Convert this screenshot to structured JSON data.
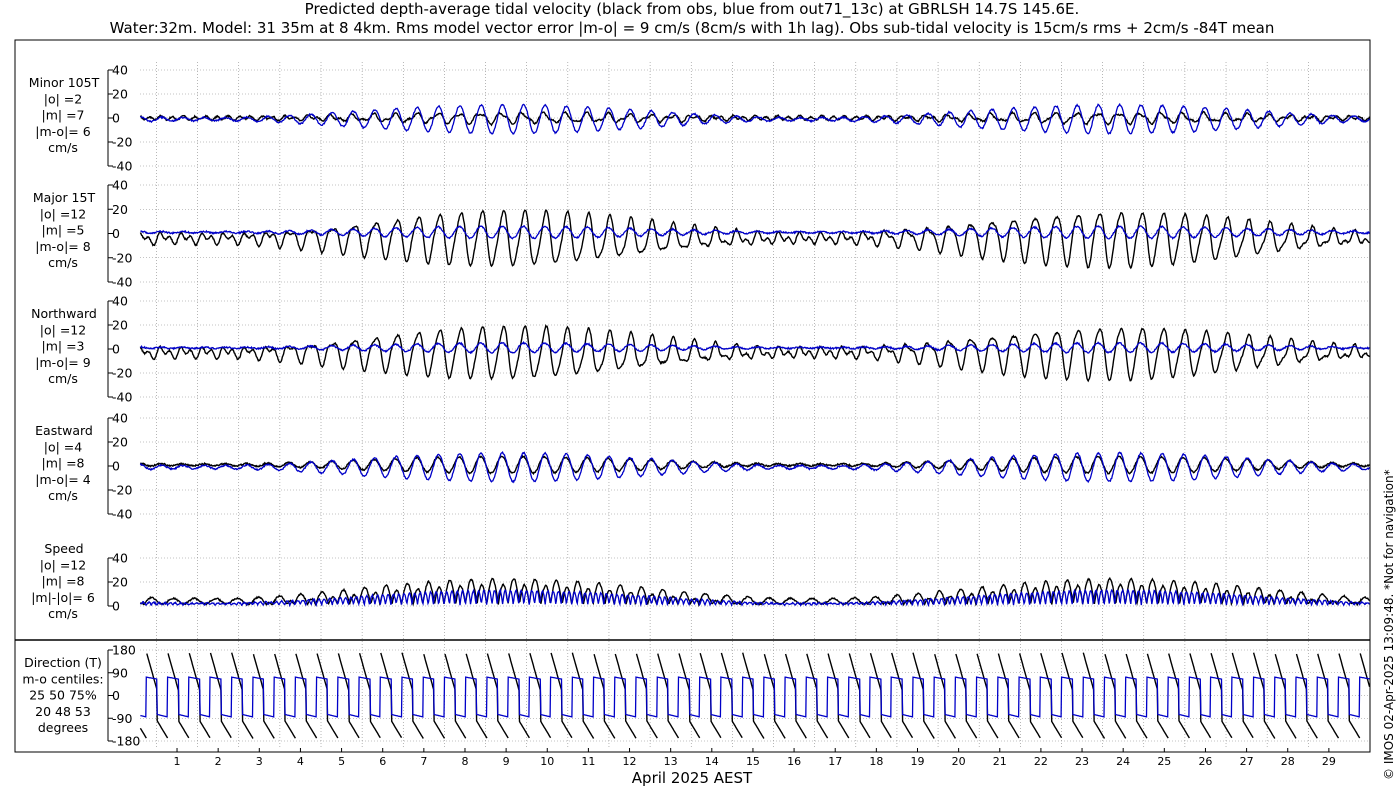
{
  "title_line1": "Predicted depth-average tidal velocity (black from obs, blue from out71_13c) at GBRLSH 14.7S 145.6E.",
  "title_line2": "Water:32m. Model: 31 35m at 8 4km. Rms model vector error |m-o| = 9 cm/s (8cm/s with 1h lag). Obs sub-tidal velocity is 15cm/s rms + 2cm/s -84T mean",
  "credit": "© IMOS 02-Apr-2025 13:09:48. *Not for navigation*",
  "colors": {
    "obs": "#000000",
    "model": "#0000c8",
    "grid": "#888888"
  },
  "chart_data": {
    "type": "line",
    "xlabel": "April 2025 AEST",
    "x_ticks": [
      "1",
      "2",
      "3",
      "4",
      "5",
      "6",
      "7",
      "8",
      "9",
      "10",
      "11",
      "12",
      "13",
      "14",
      "15",
      "16",
      "17",
      "18",
      "19",
      "20",
      "21",
      "22",
      "23",
      "24",
      "25",
      "26",
      "27",
      "28",
      "29"
    ],
    "x_range_days": [
      0.1,
      30.0
    ],
    "legend": "none",
    "grid": true,
    "panels": [
      {
        "key": "minor",
        "labels": [
          "Minor 105T",
          "|o| =2",
          "|m| =7",
          "|m-o|= 6",
          "cm/s"
        ],
        "ylim": [
          -40,
          40
        ],
        "yticks": [
          "40",
          "20",
          "0",
          "-20",
          "-40"
        ],
        "series": [
          {
            "role": "obs",
            "description": "black",
            "amplitude_rms": 2
          },
          {
            "role": "model",
            "description": "blue",
            "amplitude_rms": 7
          }
        ]
      },
      {
        "key": "major",
        "labels": [
          "Major 15T",
          "|o| =12",
          "|m| =5",
          "|m-o|= 8",
          "cm/s"
        ],
        "ylim": [
          -40,
          40
        ],
        "yticks": [
          "40",
          "20",
          "0",
          "-20",
          "-40"
        ],
        "series": [
          {
            "role": "obs",
            "amplitude_rms": 12
          },
          {
            "role": "model",
            "amplitude_rms": 5
          }
        ]
      },
      {
        "key": "north",
        "labels": [
          "Northward",
          "|o| =12",
          "|m| =3",
          "|m-o|= 9",
          "cm/s"
        ],
        "ylim": [
          -40,
          40
        ],
        "yticks": [
          "40",
          "20",
          "0",
          "-20",
          "-40"
        ],
        "series": [
          {
            "role": "obs",
            "amplitude_rms": 12
          },
          {
            "role": "model",
            "amplitude_rms": 3
          }
        ]
      },
      {
        "key": "east",
        "labels": [
          "Eastward",
          "|o| =4",
          "|m| =8",
          "|m-o|= 4",
          "cm/s"
        ],
        "ylim": [
          -40,
          40
        ],
        "yticks": [
          "40",
          "20",
          "0",
          "-20",
          "-40"
        ],
        "series": [
          {
            "role": "obs",
            "amplitude_rms": 4
          },
          {
            "role": "model",
            "amplitude_rms": 8
          }
        ]
      },
      {
        "key": "speed",
        "labels": [
          "Speed",
          "|o| =12",
          "|m| =8",
          "|m|-|o|= 6",
          "cm/s"
        ],
        "ylim": [
          0,
          40
        ],
        "yticks": [
          "40",
          "20",
          "0"
        ],
        "series": [
          {
            "role": "obs",
            "amplitude_rms": 12
          },
          {
            "role": "model",
            "amplitude_rms": 8
          }
        ]
      },
      {
        "key": "direction",
        "labels": [
          "Direction (T)",
          "m-o centiles:",
          "25  50  75%",
          "20  48  53",
          "degrees"
        ],
        "ylim": [
          -180,
          180
        ],
        "yticks": [
          "180",
          "90",
          "0",
          "-90",
          "-180"
        ],
        "series": [
          {
            "role": "obs"
          },
          {
            "role": "model"
          }
        ]
      }
    ]
  }
}
